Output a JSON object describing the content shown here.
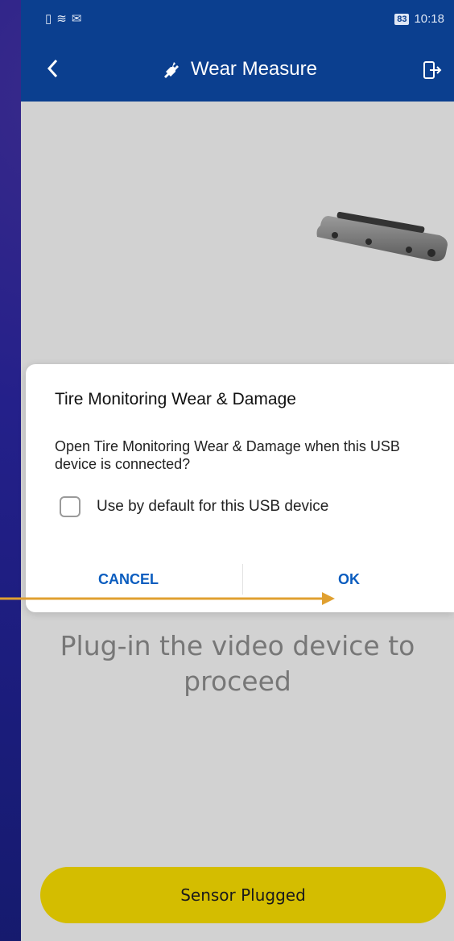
{
  "status_bar": {
    "battery": "83",
    "time": "10:18"
  },
  "app_bar": {
    "title": "Wear Measure"
  },
  "main": {
    "hint": "Plug-in the video device to proceed",
    "sensor_button": "Sensor Plugged"
  },
  "dialog": {
    "title": "Tire Monitoring Wear & Damage",
    "message": "Open Tire Monitoring Wear & Damage when this USB device is connected?",
    "checkbox_label": "Use by default for this USB device",
    "checkbox_checked": false,
    "cancel_label": "CANCEL",
    "ok_label": "OK"
  },
  "colors": {
    "appbar": "#0b3f8f",
    "accent": "#0b5dbf",
    "button_yellow": "#d4bd00",
    "arrow": "#e0a030"
  },
  "icons": [
    "back-icon",
    "plug-icon",
    "exit-icon",
    "usb-camera-image",
    "checkbox-icon"
  ]
}
